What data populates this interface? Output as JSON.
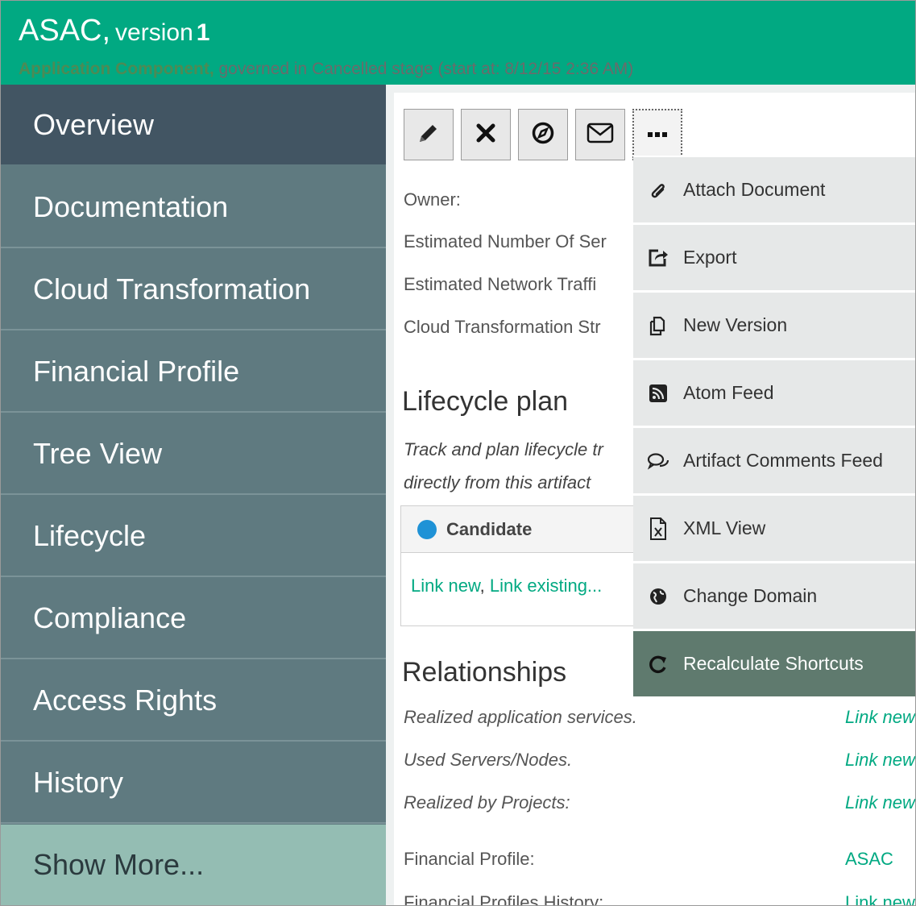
{
  "header": {
    "name": "ASAC,",
    "version_word": "version",
    "version_num": "1",
    "subtitle_bold": "Application Component,",
    "subtitle_rest": " governed in Cancelled stage (start at: 8/12/15 2:36 AM)"
  },
  "sidebar": {
    "items": [
      {
        "label": "Overview"
      },
      {
        "label": "Documentation"
      },
      {
        "label": "Cloud Transformation"
      },
      {
        "label": "Financial Profile"
      },
      {
        "label": "Tree View"
      },
      {
        "label": "Lifecycle"
      },
      {
        "label": "Compliance"
      },
      {
        "label": "Access Rights"
      },
      {
        "label": "History"
      },
      {
        "label": "Show More..."
      }
    ]
  },
  "toolbar": {
    "buttons": [
      {
        "icon": "pencil-icon"
      },
      {
        "icon": "close-icon"
      },
      {
        "icon": "compass-icon"
      },
      {
        "icon": "envelope-icon"
      },
      {
        "icon": "more-icon"
      }
    ]
  },
  "overview": {
    "fields": [
      {
        "label": "Owner:"
      },
      {
        "label": "Estimated Number Of Ser"
      },
      {
        "label": "Estimated Network Traffi"
      },
      {
        "label": "Cloud Transformation Str"
      }
    ]
  },
  "lifecycle": {
    "heading": "Lifecycle plan",
    "desc_line1": "Track and plan lifecycle tr",
    "desc_line2": "directly from this artifact",
    "candidate_label": "Candidate",
    "link_new": "Link new",
    "link_sep": ", ",
    "link_existing": "Link existing..."
  },
  "relationships": {
    "heading": "Relationships",
    "rows": [
      {
        "label": "Realized application services.",
        "link": "Link new"
      },
      {
        "label": "Used Servers/Nodes.",
        "link": "Link new"
      },
      {
        "label": "Realized by Projects:",
        "link": "Link new"
      }
    ]
  },
  "financial": {
    "profile_label": "Financial Profile:",
    "profile_value": "ASAC",
    "history_label": "Financial Profiles History:",
    "history_link": "Link new"
  },
  "menu": {
    "items": [
      {
        "label": "Attach Document",
        "icon": "paperclip-icon"
      },
      {
        "label": "Export",
        "icon": "export-icon"
      },
      {
        "label": "New Version",
        "icon": "copy-icon"
      },
      {
        "label": "Atom Feed",
        "icon": "rss-icon"
      },
      {
        "label": "Artifact Comments Feed",
        "icon": "comments-icon"
      },
      {
        "label": "XML View",
        "icon": "xml-file-icon"
      },
      {
        "label": "Change Domain",
        "icon": "globe-icon"
      },
      {
        "label": "Recalculate Shortcuts",
        "icon": "refresh-icon"
      }
    ]
  },
  "colors": {
    "header_bg": "#01a982",
    "sidebar_bg": "#5f7a80",
    "sidebar_active": "#425563",
    "show_more_bg": "#94bdb3",
    "link": "#01a982",
    "menu_bg": "#e6e8e8",
    "menu_highlight": "#5f7a6e"
  }
}
